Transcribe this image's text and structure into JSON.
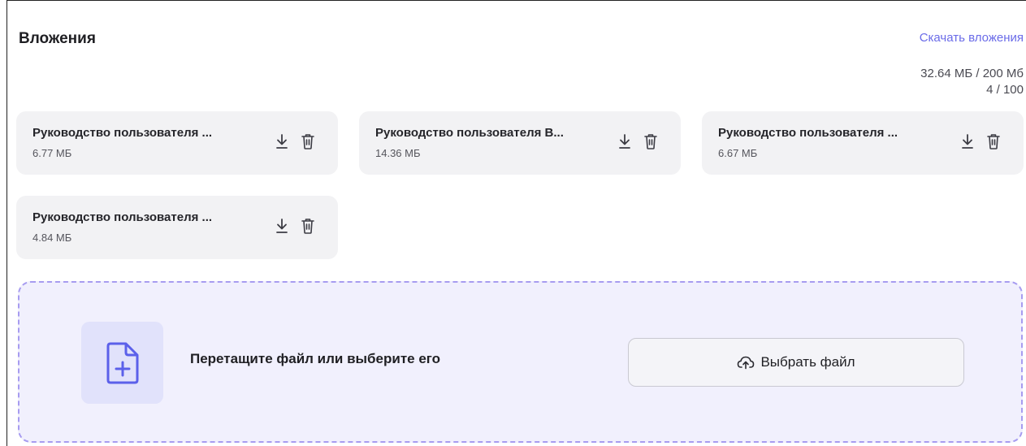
{
  "section": {
    "title": "Вложения",
    "download_all_label": "Скачать вложения",
    "size_usage": "32.64 МБ / 200 Мб",
    "count_usage": "4 / 100"
  },
  "attachments": [
    {
      "name": "Руководство пользователя ...",
      "size": "6.77 МБ"
    },
    {
      "name": "Руководство пользователя В...",
      "size": "14.36 МБ"
    },
    {
      "name": "Руководство пользователя ...",
      "size": "6.67 МБ"
    },
    {
      "name": "Руководство пользователя ...",
      "size": "4.84 МБ"
    }
  ],
  "dropzone": {
    "hint": "Перетащите файл или выберите его",
    "button_label": "Выбрать файл",
    "icons": {
      "file": "file-plus-icon",
      "upload": "cloud-upload-icon"
    }
  },
  "icons": {
    "download": "download-icon",
    "delete": "trash-icon"
  },
  "colors": {
    "accent": "#6a6be8",
    "dropzone_border": "#a79cf0",
    "dropzone_bg": "#f1f0fd",
    "card_bg": "#f2f2f4"
  }
}
